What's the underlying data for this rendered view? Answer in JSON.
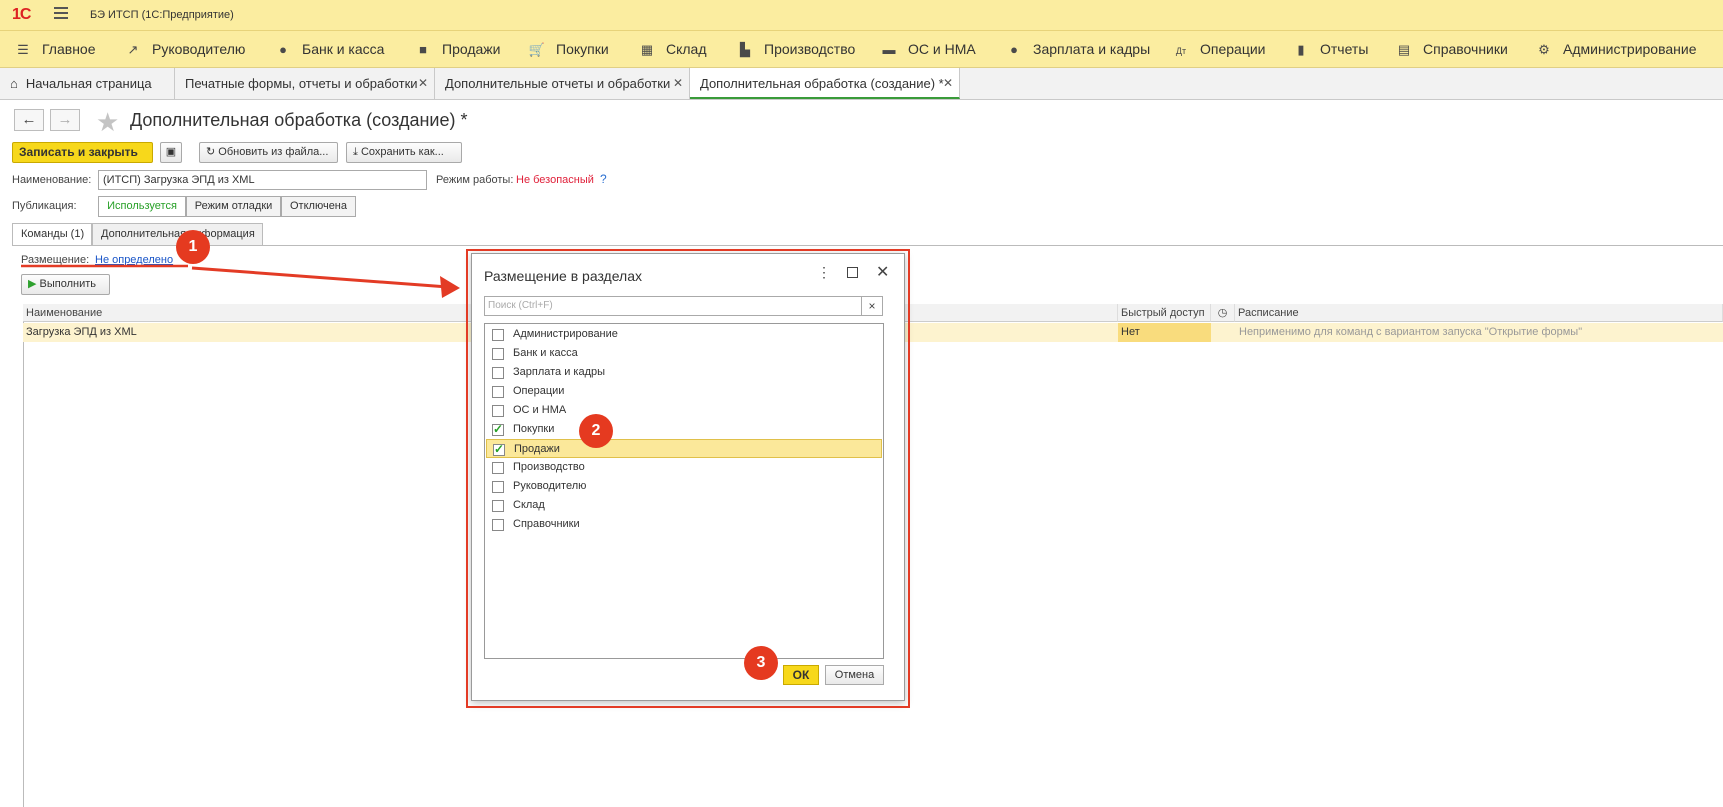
{
  "app": {
    "logo": "1С",
    "title": "БЭ ИТСП  (1С:Предприятие)"
  },
  "sections": [
    {
      "label": "Главное",
      "icon": "menu-icon"
    },
    {
      "label": "Руководителю",
      "icon": "trend-icon"
    },
    {
      "label": "Банк и касса",
      "icon": "ruble-icon"
    },
    {
      "label": "Продажи",
      "icon": "bag-icon"
    },
    {
      "label": "Покупки",
      "icon": "cart-icon"
    },
    {
      "label": "Склад",
      "icon": "warehouse-icon"
    },
    {
      "label": "Производство",
      "icon": "factory-icon"
    },
    {
      "label": "ОС и НМА",
      "icon": "truck-icon"
    },
    {
      "label": "Зарплата и кадры",
      "icon": "person-icon"
    },
    {
      "label": "Операции",
      "icon": "operations-icon"
    },
    {
      "label": "Отчеты",
      "icon": "chart-icon"
    },
    {
      "label": "Справочники",
      "icon": "books-icon"
    },
    {
      "label": "Администрирование",
      "icon": "gear-icon"
    }
  ],
  "tabs": [
    {
      "label": "Начальная страница"
    },
    {
      "label": "Печатные формы, отчеты и обработки"
    },
    {
      "label": "Дополнительные отчеты и обработки"
    },
    {
      "label": "Дополнительная обработка (создание) *"
    }
  ],
  "form": {
    "title": "Дополнительная обработка (создание) *",
    "save_close": "Записать и закрыть",
    "update_from_file": "Обновить из файла...",
    "save_as": "Сохранить как...",
    "name_label": "Наименование:",
    "name_value": "(ИТСП) Загрузка ЭПД из XML",
    "mode_label": "Режим работы:",
    "mode_value": "Не безопасный",
    "help": "?",
    "publication_label": "Публикация:",
    "publication_options": [
      "Используется",
      "Режим отладки",
      "Отключена"
    ],
    "subtabs": [
      "Команды (1)",
      "Дополнительная информация"
    ],
    "placement_label": "Размещение:",
    "placement_value": "Не определено",
    "run_button": "Выполнить",
    "table": {
      "headers": [
        "Наименование",
        "Быстрый доступ",
        "Расписание"
      ],
      "row": {
        "name": "Загрузка ЭПД из XML",
        "quick": "Нет",
        "schedule": "Неприменимо для команд с вариантом запуска \"Открытие формы\""
      }
    }
  },
  "modal": {
    "title": "Размещение в разделах",
    "search_placeholder": "Поиск (Ctrl+F)",
    "clear": "×",
    "items": [
      {
        "label": "Администрирование",
        "checked": false
      },
      {
        "label": "Банк и касса",
        "checked": false
      },
      {
        "label": "Зарплата и кадры",
        "checked": false
      },
      {
        "label": "Операции",
        "checked": false
      },
      {
        "label": "ОС и НМА",
        "checked": false
      },
      {
        "label": "Покупки",
        "checked": true
      },
      {
        "label": "Продажи",
        "checked": true
      },
      {
        "label": "Производство",
        "checked": false
      },
      {
        "label": "Руководителю",
        "checked": false
      },
      {
        "label": "Склад",
        "checked": false
      },
      {
        "label": "Справочники",
        "checked": false
      }
    ],
    "ok": "ОК",
    "cancel": "Отмена"
  },
  "annotations": {
    "badge1": "1",
    "badge2": "2",
    "badge3": "3",
    "color": "#e53a20"
  }
}
